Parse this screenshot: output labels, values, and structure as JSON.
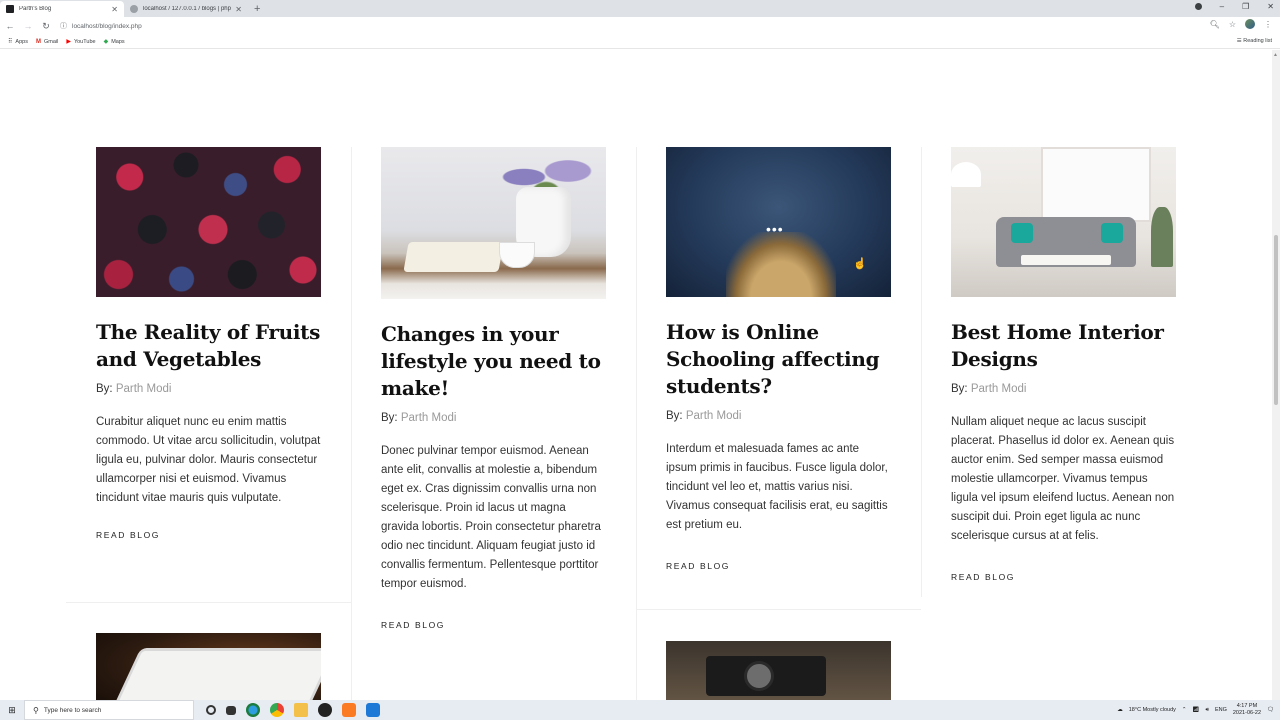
{
  "browser": {
    "tabs": [
      {
        "title": "Parth's Blog",
        "active": true
      },
      {
        "title": "localhost / 127.0.0.1 / blogs | php",
        "active": false
      }
    ],
    "url": "localhost/blog/index.php",
    "bookmarks": [
      {
        "label": "Apps",
        "icon": "apps-grid-icon"
      },
      {
        "label": "Gmail",
        "icon": "gmail-icon"
      },
      {
        "label": "YouTube",
        "icon": "youtube-icon"
      },
      {
        "label": "Maps",
        "icon": "maps-icon"
      }
    ],
    "reading_list": "Reading list"
  },
  "posts": [
    {
      "title": "The Reality of Fruits and Vegetables",
      "by_label": "By:",
      "author": "Parth Modi",
      "excerpt": "Curabitur aliquet nunc eu enim mattis commodo. Ut vitae arcu sollicitudin, volutpat ligula eu, pulvinar dolor. Mauris consectetur ullamcorper nisi et euismod. Vivamus tincidunt vitae mauris quis vulputate.",
      "cta": "READ BLOG",
      "image": "berries"
    },
    {
      "title": "Changes in your lifestyle you need to make!",
      "by_label": "By:",
      "author": "Parth Modi",
      "excerpt": "Donec pulvinar tempor euismod. Aenean ante elit, convallis at molestie a, bibendum eget ex. Cras dignissim convallis urna non scelerisque. Proin id lacus ut magna gravida lobortis. Proin consectetur pharetra odio nec tincidunt. Aliquam feugiat justo id convallis fermentum. Pellentesque porttitor tempor euismod.",
      "cta": "READ BLOG",
      "image": "tea-and-book"
    },
    {
      "title": "How is Online Schooling affecting students?",
      "by_label": "By:",
      "author": "Parth Modi",
      "excerpt": "Interdum et malesuada fames ac ante ipsum primis in faucibus. Fusce ligula dolor, tincidunt vel leo et, mattis varius nisi. Vivamus consequat facilisis erat, eu sagittis est pretium eu.",
      "cta": "READ BLOG",
      "image": "open-book-night",
      "loading_dots": "•••"
    },
    {
      "title": "Best Home Interior Designs",
      "by_label": "By:",
      "author": "Parth Modi",
      "excerpt": "Nullam aliquet neque ac lacus suscipit placerat. Phasellus id dolor ex. Aenean quis auctor enim. Sed semper massa euismod molestie ullamcorper. Vivamus tempus ligula vel ipsum eleifend luctus. Aenean non suscipit dui. Proin eget ligula ac nunc scelerisque cursus at at felis.",
      "cta": "READ BLOG",
      "image": "living-room"
    }
  ],
  "taskbar": {
    "search_placeholder": "Type here to search",
    "weather": "18°C  Mostly cloudy",
    "language": "ENG",
    "time": "4:17 PM",
    "date": "2021-06-22"
  },
  "colors": {
    "accent_text": "#111111",
    "author_name": "#999999",
    "divider": "#efefef"
  }
}
